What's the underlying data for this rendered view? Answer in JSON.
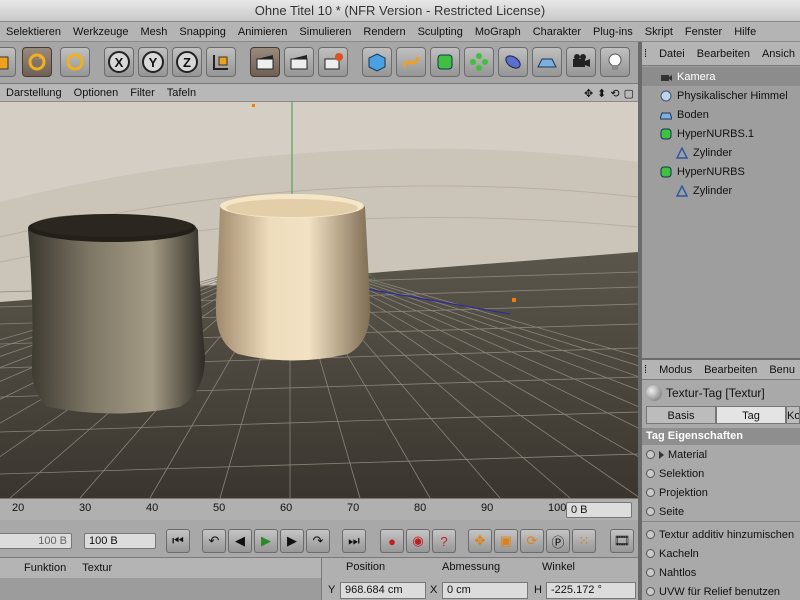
{
  "window": {
    "title": "Ohne Titel 10 * (NFR Version - Restricted License)"
  },
  "menubar": [
    "Selektieren",
    "Werkzeuge",
    "Mesh",
    "Snapping",
    "Animieren",
    "Simulieren",
    "Rendern",
    "Sculpting",
    "MoGraph",
    "Charakter",
    "Plug-ins",
    "Skript",
    "Fenster",
    "Hilfe"
  ],
  "toolbar": {
    "x_label": "X",
    "y_label": "Y",
    "z_label": "Z"
  },
  "viewport_menu": [
    "Darstellung",
    "Optionen",
    "Filter",
    "Tafeln"
  ],
  "viewport_icons": [
    "✥",
    "⬍",
    "⟲",
    "▢"
  ],
  "timeline": {
    "ticks": [
      "20",
      "30",
      "40",
      "50",
      "60",
      "70",
      "80",
      "90",
      "100"
    ],
    "frame_field": "0 B"
  },
  "transport": {
    "start_field": "100 B",
    "end_field": "100 B"
  },
  "material_menu": [
    "Funktion",
    "Textur"
  ],
  "coordinates": {
    "headers": [
      "Position",
      "Abmessung",
      "Winkel"
    ],
    "fields": [
      {
        "label": "Y",
        "value": "968.684 cm"
      },
      {
        "label": "X",
        "value": "0 cm"
      },
      {
        "label": "H",
        "value": "-225.172 °"
      }
    ]
  },
  "object_manager": {
    "menu": [
      "Datei",
      "Bearbeiten",
      "Ansich"
    ],
    "objects": [
      {
        "name": "Kamera",
        "icon": "camera-icon",
        "indent": 0,
        "color": "#ffffff"
      },
      {
        "name": "Physikalischer Himmel",
        "icon": "sky-icon",
        "indent": 0,
        "color": "#111111"
      },
      {
        "name": "Boden",
        "icon": "floor-icon",
        "indent": 0,
        "color": "#111111"
      },
      {
        "name": "HyperNURBS.1",
        "icon": "hypernurbs-icon",
        "indent": 0,
        "color": "#111111"
      },
      {
        "name": "Zylinder",
        "icon": "cylinder-icon",
        "indent": 1,
        "color": "#111111"
      },
      {
        "name": "HyperNURBS",
        "icon": "hypernurbs-icon",
        "indent": 0,
        "color": "#111111"
      },
      {
        "name": "Zylinder",
        "icon": "cylinder-icon",
        "indent": 1,
        "color": "#111111"
      }
    ]
  },
  "attribute_manager": {
    "menu": [
      "Modus",
      "Bearbeiten",
      "Benu"
    ],
    "tag_title": "Textur-Tag [Textur]",
    "tabs": [
      "Basis",
      "Tag",
      "Ko"
    ],
    "active_tab": "Tag",
    "section": "Tag Eigenschaften",
    "props_top": [
      "Material",
      "Selektion",
      "Projektion",
      "Seite"
    ],
    "props_bottom": [
      "Textur additiv hinzumischen",
      "Kacheln",
      "Nahtlos",
      "UVW für Relief benutzen"
    ]
  }
}
